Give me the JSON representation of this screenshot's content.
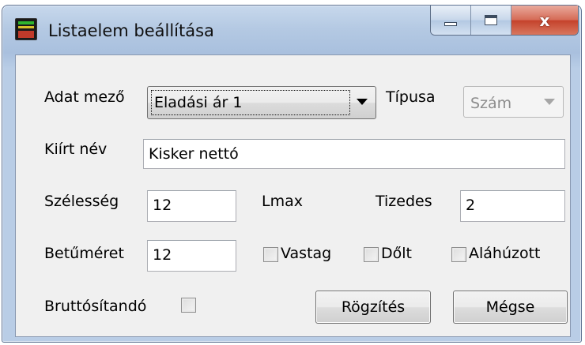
{
  "window": {
    "title": "Listaelem beállítása",
    "close_glyph": "x"
  },
  "form": {
    "data_field": {
      "label": "Adat mező",
      "value": "Eladási ár 1"
    },
    "type": {
      "label": "Típusa",
      "value": "Szám",
      "enabled": false
    },
    "display_name": {
      "label": "Kiírt név",
      "value": "Kisker nettó"
    },
    "width": {
      "label": "Szélesség",
      "value": "12"
    },
    "lmax": {
      "label": "Lmax"
    },
    "decimals": {
      "label": "Tizedes",
      "value": "2"
    },
    "font_size": {
      "label": "Betűméret",
      "value": "12"
    },
    "bold": {
      "label": "Vastag",
      "checked": false
    },
    "italic": {
      "label": "Dőlt",
      "checked": false
    },
    "underline": {
      "label": "Aláhúzott",
      "checked": false
    },
    "gross": {
      "label": "Bruttósítandó",
      "checked": false
    }
  },
  "buttons": {
    "save": "Rögzítés",
    "cancel": "Mégse"
  },
  "colors": {
    "frame": "#b4c9e3",
    "client": "#f0f0f0",
    "close_button": "#c4412b"
  }
}
